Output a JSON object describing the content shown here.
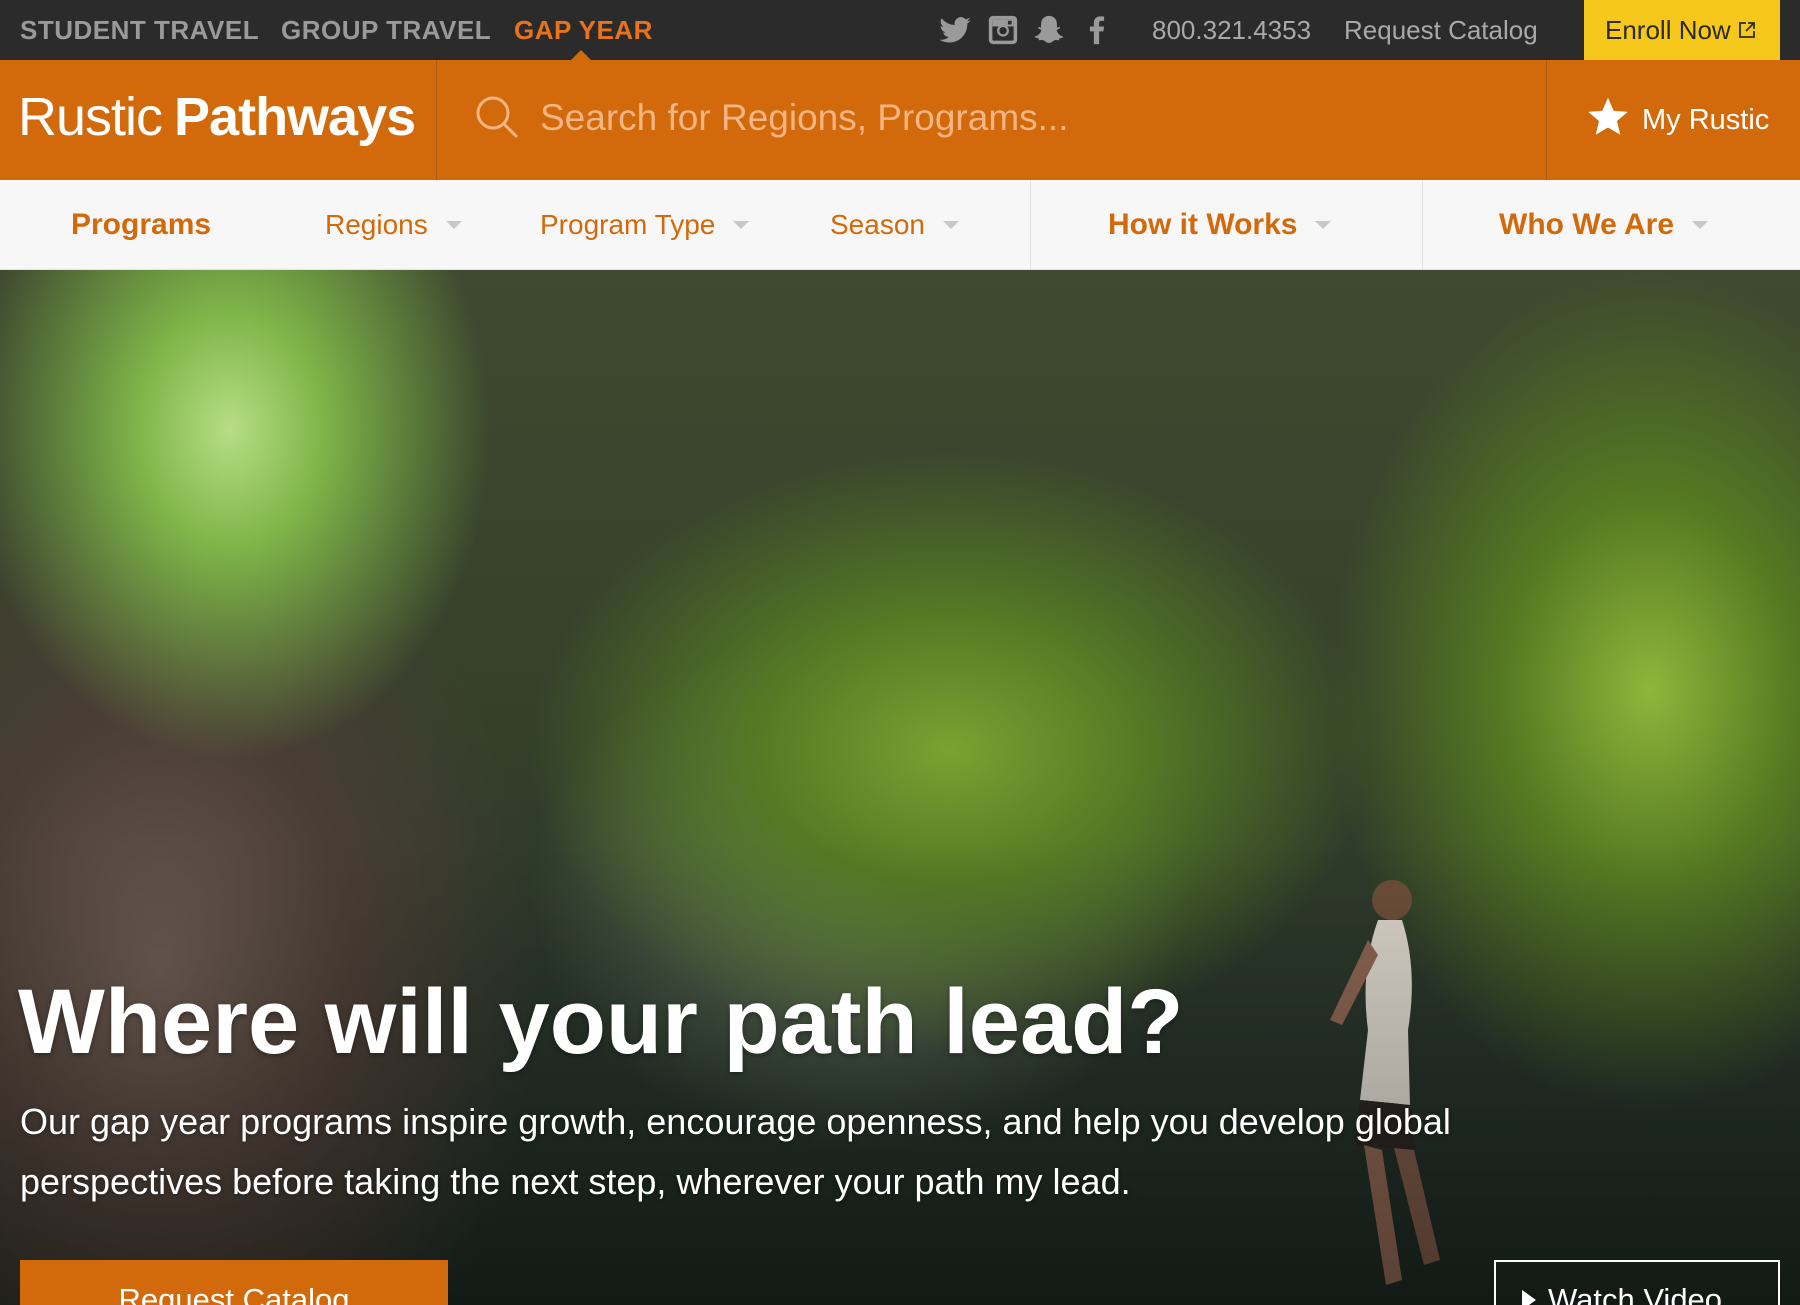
{
  "topbar": {
    "segments": [
      {
        "label": "STUDENT TRAVEL"
      },
      {
        "label": "GROUP TRAVEL"
      },
      {
        "label": "GAP YEAR",
        "active": true
      }
    ],
    "social_icons": [
      "twitter-icon",
      "instagram-icon",
      "snapchat-icon",
      "facebook-icon"
    ],
    "phone": "800.321.4353",
    "request_catalog": "Request Catalog",
    "enroll": "Enroll Now"
  },
  "brand": {
    "logo_light": "Rustic",
    "logo_bold": "Pathways",
    "search_placeholder": "Search for Regions, Programs...",
    "my_rustic": "My Rustic"
  },
  "nav": {
    "programs": "Programs",
    "regions": "Regions",
    "program_type": "Program Type",
    "season": "Season",
    "how_it_works": "How it Works",
    "who_we_are": "Who We Are"
  },
  "hero": {
    "title": "Where will your path lead?",
    "text": "Our gap year programs inspire growth, encourage openness, and help you develop global perspectives before taking the next step, wherever your path my lead.",
    "cta_catalog": "Request Catalog",
    "cta_video": "Watch Video"
  },
  "colors": {
    "brand_orange": "#d2690b",
    "topbar_dark": "#2b2b2b",
    "enroll_yellow": "#f7c81c"
  }
}
